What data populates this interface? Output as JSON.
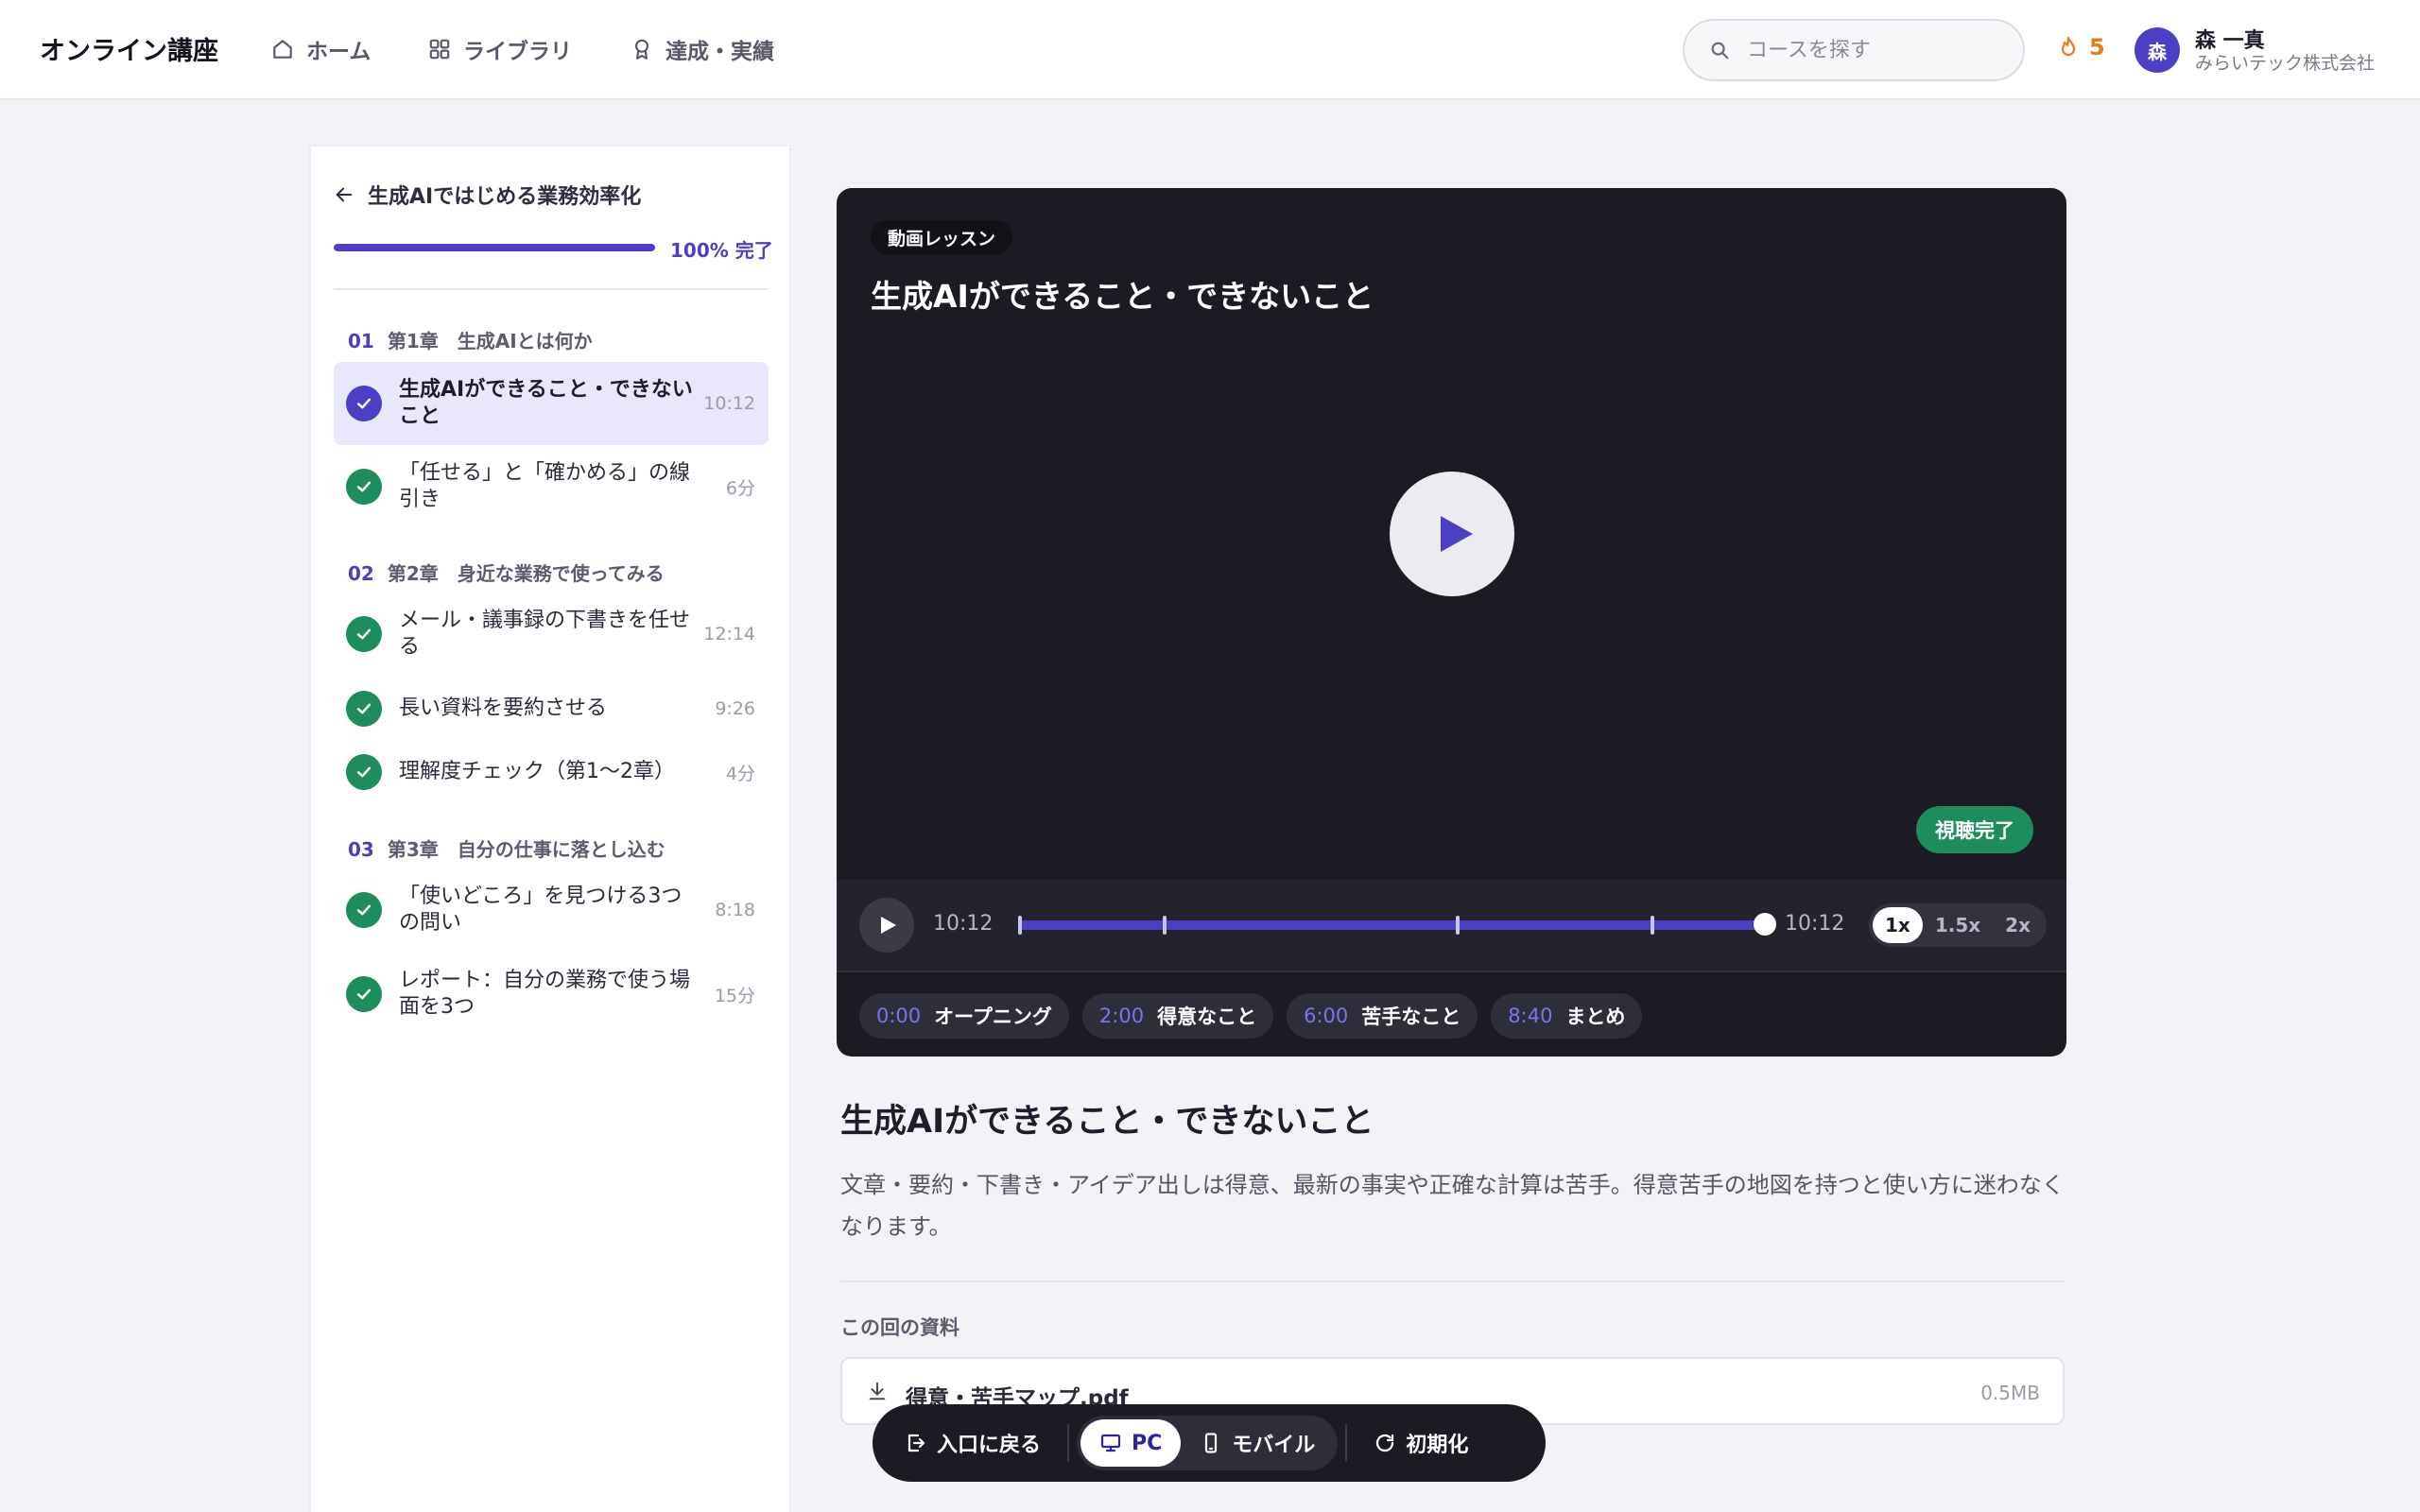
{
  "header": {
    "brand": "オンライン講座",
    "nav": [
      {
        "label": "ホーム",
        "icon": "home-icon"
      },
      {
        "label": "ライブラリ",
        "icon": "grid-icon"
      },
      {
        "label": "達成・実績",
        "icon": "award-icon"
      }
    ],
    "search_placeholder": "コースを探す",
    "streak": "5",
    "user": {
      "initial": "森",
      "name": "森 一真",
      "company": "みらいテック株式会社"
    }
  },
  "sidebar": {
    "course_title": "生成AIではじめる業務効率化",
    "progress_percent": 100,
    "progress_label": "100% 完了",
    "chapters": [
      {
        "num": "01",
        "title": "第1章　生成AIとは何か"
      },
      {
        "num": "02",
        "title": "第2章　身近な業務で使ってみる"
      },
      {
        "num": "03",
        "title": "第3章　自分の仕事に落とし込む"
      }
    ],
    "lessons": [
      {
        "title": "生成AIができること・できないこと",
        "duration": "10:12",
        "status": "current"
      },
      {
        "title": "「任せる」と「確かめる」の線引き",
        "duration": "6分",
        "status": "completed"
      },
      {
        "title": "メール・議事録の下書きを任せる",
        "duration": "12:14",
        "status": "completed"
      },
      {
        "title": "長い資料を要約させる",
        "duration": "9:26",
        "status": "completed"
      },
      {
        "title": "理解度チェック（第1〜2章）",
        "duration": "4分",
        "status": "completed"
      },
      {
        "title": "「使いどころ」を見つける3つの問い",
        "duration": "8:18",
        "status": "completed"
      },
      {
        "title": "レポート：自分の業務で使う場面を3つ",
        "duration": "15分",
        "status": "completed"
      }
    ]
  },
  "video": {
    "badge": "動画レッスン",
    "title": "生成AIができること・できないこと",
    "watched_label": "視聴完了",
    "current_time": "10:12",
    "duration": "10:12",
    "progress_fraction": 1.0,
    "chapter_markers": [
      "0:00",
      "2:00",
      "6:00",
      "8:40",
      "10:12"
    ],
    "speeds": [
      "1x",
      "1.5x",
      "2x"
    ],
    "selected_speed": "1x",
    "chapters": [
      {
        "time": "0:00",
        "label": "オープニング"
      },
      {
        "time": "2:00",
        "label": "得意なこと"
      },
      {
        "time": "6:00",
        "label": "苦手なこと"
      },
      {
        "time": "8:40",
        "label": "まとめ"
      }
    ]
  },
  "lesson": {
    "title": "生成AIができること・できないこと",
    "description": "文章・要約・下書き・アイデア出しは得意、最新の事実や正確な計算は苦手。得意苦手の地図を持つと使い方に迷わなくなります。",
    "materials_label": "この回の資料",
    "materials": [
      {
        "name": "得意・苦手マップ.pdf",
        "size": "0.5MB"
      }
    ]
  },
  "toolbar": {
    "back": "入口に戻る",
    "pc": "PC",
    "mobile": "モバイル",
    "reset": "初期化",
    "selected_view": "PC"
  },
  "colors": {
    "accent": "#4b3fc4",
    "success": "#1e8d5c",
    "streak": "#ea7a1a",
    "video_bg": "#1c1b24"
  }
}
